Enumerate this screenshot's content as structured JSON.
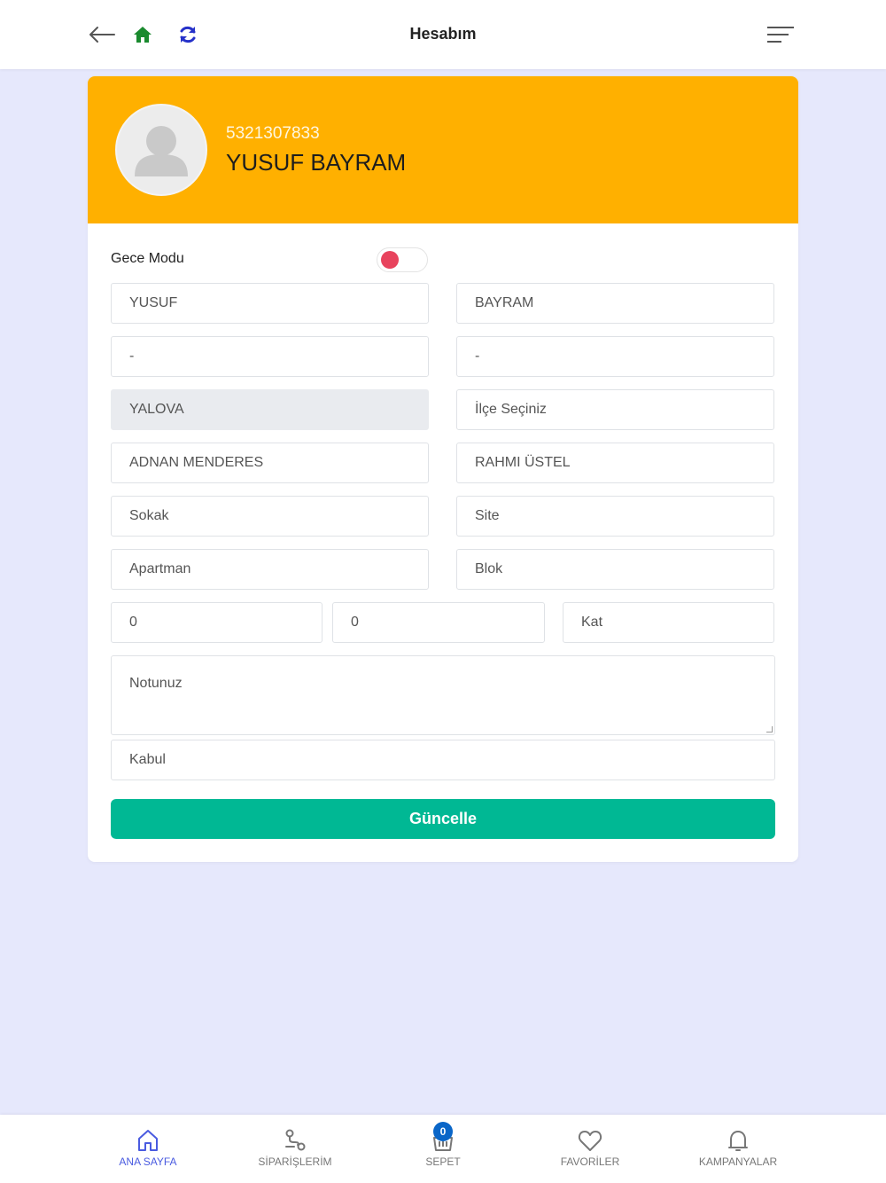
{
  "header": {
    "title": "Hesabım"
  },
  "profile": {
    "phone": "5321307833",
    "name": "YUSUF BAYRAM"
  },
  "form": {
    "night_mode_label": "Gece Modu",
    "night_mode_on": false,
    "first_name": "YUSUF",
    "last_name": "BAYRAM",
    "field3": "-",
    "field4": "-",
    "city": "YALOVA",
    "district_placeholder": "İlçe Seçiniz",
    "neighborhood": "ADNAN MENDERES",
    "street_main": "RAHMI ÜSTEL",
    "street_placeholder": "Sokak",
    "site_placeholder": "Site",
    "apartment_placeholder": "Apartman",
    "block_placeholder": "Blok",
    "number1": "0",
    "number2": "0",
    "floor_placeholder": "Kat",
    "note_placeholder": "Notunuz",
    "accept_placeholder": "Kabul",
    "update_label": "Güncelle"
  },
  "bottom_nav": {
    "items": [
      {
        "label": "ANA SAYFA",
        "icon": "home-icon",
        "active": true
      },
      {
        "label": "SİPARİŞLERİM",
        "icon": "route-icon",
        "active": false
      },
      {
        "label": "SEPET",
        "icon": "basket-icon",
        "active": false,
        "badge": "0"
      },
      {
        "label": "FAVORİLER",
        "icon": "heart-icon",
        "active": false
      },
      {
        "label": "KAMPANYALAR",
        "icon": "bell-icon",
        "active": false
      }
    ]
  },
  "colors": {
    "header_bg": "#ffb000",
    "button": "#00b894",
    "toggle_knob": "#e8435d",
    "nav_active": "#4a5be0",
    "page_bg": "#e6e8fc"
  }
}
